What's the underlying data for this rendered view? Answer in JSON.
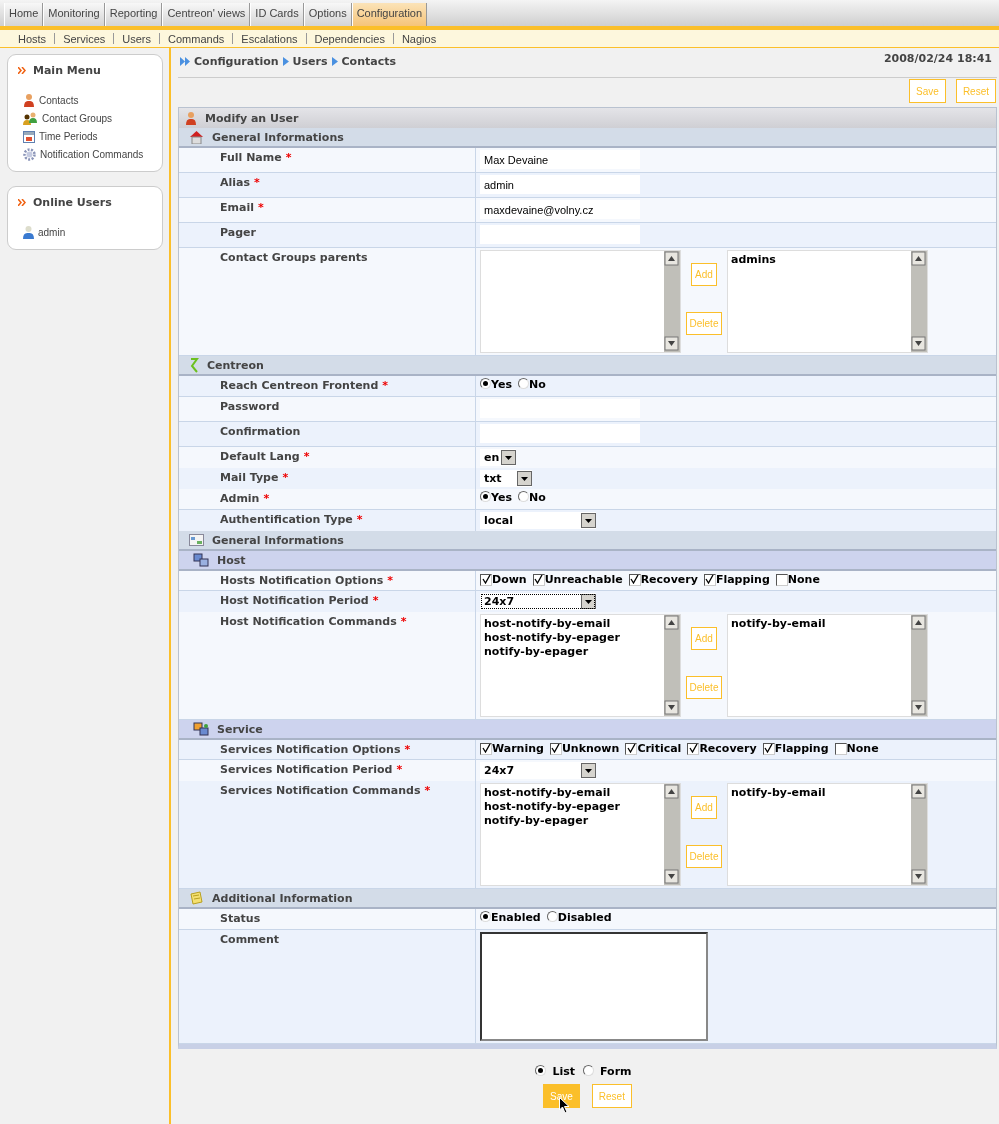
{
  "top_menu": [
    {
      "label": "Home",
      "selected": false
    },
    {
      "label": "Monitoring",
      "selected": false
    },
    {
      "label": "Reporting",
      "selected": false
    },
    {
      "label": "Centreon' views",
      "selected": false
    },
    {
      "label": "ID Cards",
      "selected": false
    },
    {
      "label": "Options",
      "selected": false
    },
    {
      "label": "Configuration",
      "selected": true
    }
  ],
  "sub_menu": [
    "Hosts",
    "Services",
    "Users",
    "Commands",
    "Escalations",
    "Dependencies",
    "Nagios"
  ],
  "sidebar": [
    {
      "title": "Main Menu",
      "items": [
        {
          "label": "Contacts"
        },
        {
          "label": "Contact Groups"
        },
        {
          "label": "Time Periods"
        },
        {
          "label": "Notification Commands"
        }
      ]
    },
    {
      "title": "Online Users",
      "items": [
        {
          "label": "admin"
        }
      ]
    }
  ],
  "breadcrumb": [
    "Configuration",
    "Users",
    "Contacts"
  ],
  "datetime": "2008/02/24 18:41",
  "top_buttons": [
    {
      "label": "Save",
      "highlighted": false
    },
    {
      "label": "Reset",
      "highlighted": false
    }
  ],
  "form": {
    "title": "Modify an User",
    "sections": [
      {
        "title": "General Informations",
        "kind": "section",
        "rows": [
          {
            "kind": "text",
            "label": "Full Name",
            "required_mark": "*",
            "value": "Max Devaine"
          },
          {
            "kind": "text",
            "label": "Alias",
            "required_mark": "*",
            "value": "admin"
          },
          {
            "kind": "text",
            "label": "Email",
            "required_mark": "*",
            "value": "maxdevaine@volny.cz"
          },
          {
            "kind": "text",
            "label": "Pager"
          },
          {
            "kind": "dual_list",
            "label": "Contact Groups parents",
            "available": [],
            "chosen": [
              "admins"
            ],
            "buttons": [
              "Add",
              "Delete"
            ]
          }
        ]
      },
      {
        "title": "Centreon",
        "kind": "section",
        "rows": [
          {
            "kind": "radio",
            "label": "Reach Centreon Frontend",
            "required_mark": "*",
            "options": [
              {
                "label": "Yes",
                "selected": true
              },
              {
                "label": "No",
                "selected": false
              }
            ]
          },
          {
            "kind": "text",
            "label": "Password"
          },
          {
            "kind": "text",
            "label": "Confirmation"
          },
          {
            "kind": "select",
            "label": "Default Lang",
            "required_mark": "*",
            "value": "en",
            "focused": false
          },
          {
            "kind": "select",
            "label": "Mail Type",
            "required_mark": "*",
            "value": "txt",
            "focused": false
          },
          {
            "kind": "radio",
            "label": "Admin",
            "required_mark": "*",
            "options": [
              {
                "label": "Yes",
                "selected": true
              },
              {
                "label": "No",
                "selected": false
              }
            ]
          },
          {
            "kind": "select",
            "label": "Authentification Type",
            "required_mark": "*",
            "value": "local",
            "focused": false
          }
        ]
      },
      {
        "title": "General Informations",
        "kind": "section"
      },
      {
        "title": "Host",
        "kind": "subsection",
        "rows": [
          {
            "kind": "checks",
            "label": "Hosts Notification Options",
            "required_mark": "*",
            "options": [
              {
                "label": "Down",
                "checked": true
              },
              {
                "label": "Unreachable",
                "checked": true
              },
              {
                "label": "Recovery",
                "checked": true
              },
              {
                "label": "Flapping",
                "checked": true
              },
              {
                "label": "None",
                "checked": false
              }
            ]
          },
          {
            "kind": "select",
            "label": "Host Notification Period",
            "required_mark": "*",
            "value": "24x7",
            "focused": true
          },
          {
            "kind": "dual_list",
            "label": "Host Notification Commands",
            "required_mark": "*",
            "available": [
              "host-notify-by-email",
              "host-notify-by-epager",
              "notify-by-epager"
            ],
            "chosen": [
              "notify-by-email"
            ],
            "buttons": [
              "Add",
              "Delete"
            ]
          }
        ]
      },
      {
        "title": "Service",
        "kind": "subsection",
        "rows": [
          {
            "kind": "checks",
            "label": "Services Notification Options",
            "required_mark": "*",
            "options": [
              {
                "label": "Warning",
                "checked": true
              },
              {
                "label": "Unknown",
                "checked": true
              },
              {
                "label": "Critical",
                "checked": true
              },
              {
                "label": "Recovery",
                "checked": true
              },
              {
                "label": "Flapping",
                "checked": true
              },
              {
                "label": "None",
                "checked": false
              }
            ]
          },
          {
            "kind": "select",
            "label": "Services Notification Period",
            "required_mark": "*",
            "value": "24x7",
            "focused": false
          },
          {
            "kind": "dual_list",
            "label": "Services Notification Commands",
            "required_mark": "*",
            "available": [
              "host-notify-by-email",
              "host-notify-by-epager",
              "notify-by-epager"
            ],
            "chosen": [
              "notify-by-email"
            ],
            "buttons": [
              "Add",
              "Delete"
            ]
          }
        ]
      },
      {
        "title": "Additional Information",
        "kind": "section",
        "rows": [
          {
            "kind": "radio",
            "label": "Status",
            "options": [
              {
                "label": "Enabled",
                "selected": true
              },
              {
                "label": "Disabled",
                "selected": false
              }
            ]
          },
          {
            "kind": "textarea",
            "label": "Comment"
          }
        ]
      }
    ]
  },
  "view_options": [
    {
      "label": "List",
      "selected": true
    },
    {
      "label": "Form",
      "selected": false
    }
  ],
  "bottom_buttons": [
    {
      "label": "Save",
      "highlighted": true
    },
    {
      "label": "Reset",
      "highlighted": false
    }
  ]
}
